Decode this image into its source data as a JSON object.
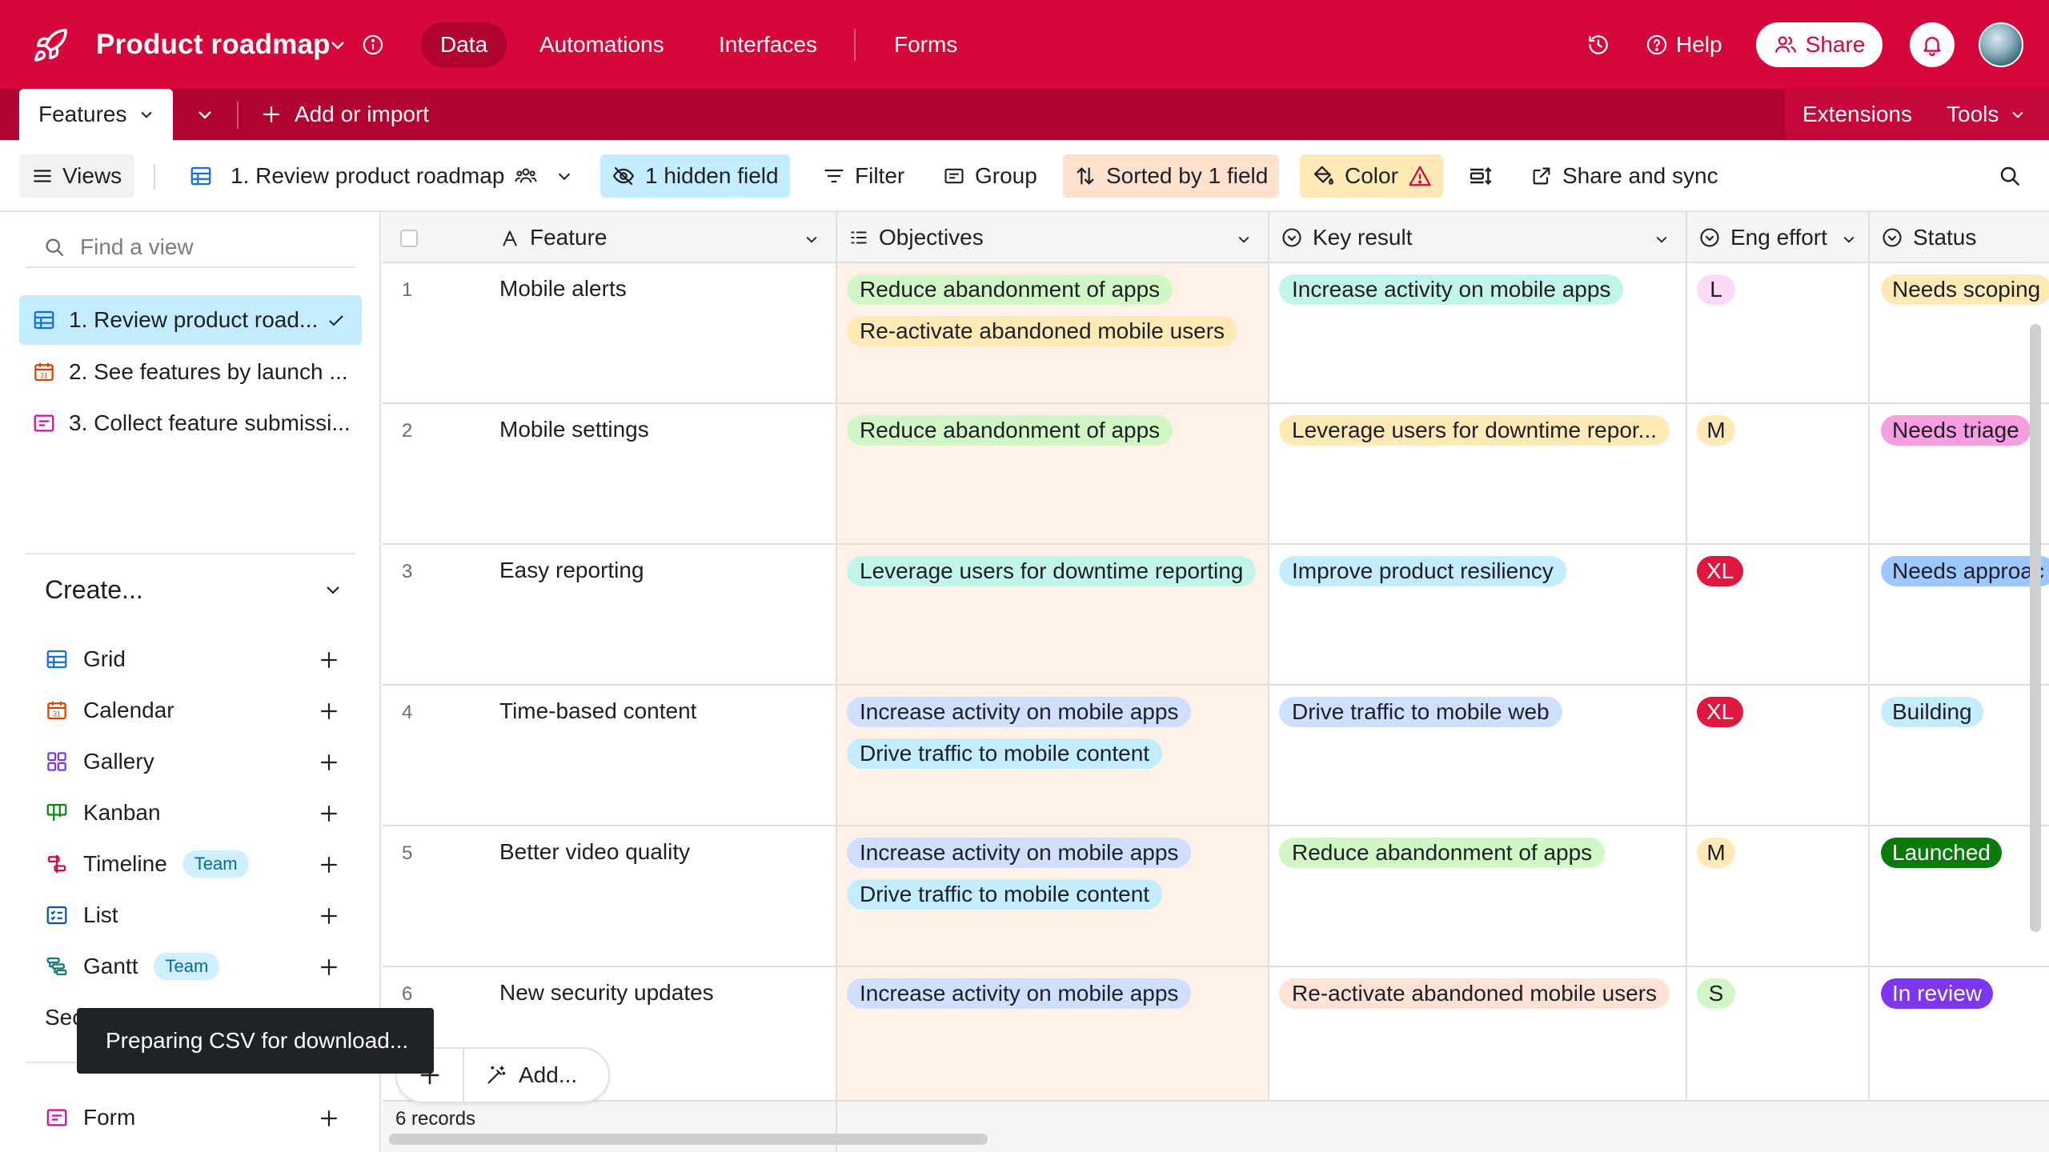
{
  "topbar": {
    "base_title": "Product roadmap",
    "nav": [
      "Data",
      "Automations",
      "Interfaces",
      "Forms"
    ],
    "help_label": "Help",
    "share_label": "Share"
  },
  "tabsbar": {
    "table_name": "Features",
    "add_import_label": "Add or import",
    "extensions_label": "Extensions",
    "tools_label": "Tools"
  },
  "viewbar": {
    "views_label": "Views",
    "current_view": "1. Review product roadmap",
    "hidden_fields": "1 hidden field",
    "filter": "Filter",
    "group": "Group",
    "sorted": "Sorted by 1 field",
    "color": "Color",
    "share_sync": "Share and sync"
  },
  "sidebar": {
    "find_placeholder": "Find a view",
    "views": [
      "1. Review product road...",
      "2. See features by launch ...",
      "3. Collect feature submissi..."
    ],
    "create_label": "Create...",
    "create_items": [
      "Grid",
      "Calendar",
      "Gallery",
      "Kanban",
      "Timeline",
      "List",
      "Gantt",
      "Sec",
      "Form"
    ],
    "team_badge": "Team"
  },
  "toast": {
    "message": "Preparing CSV for download..."
  },
  "grid": {
    "columns": [
      "Feature",
      "Objectives",
      "Key result",
      "Eng effort",
      "Status"
    ],
    "rows": [
      {
        "num": "1",
        "feature": "Mobile alerts",
        "objectives": [
          "Reduce abandonment of apps",
          "Re-activate abandoned mobile users"
        ],
        "key_result": "Increase activity on mobile apps",
        "effort": "L",
        "status": "Needs scoping"
      },
      {
        "num": "2",
        "feature": "Mobile settings",
        "objectives": [
          "Reduce abandonment of apps"
        ],
        "key_result": "Leverage users for downtime repor...",
        "effort": "M",
        "status": "Needs triage"
      },
      {
        "num": "3",
        "feature": "Easy reporting",
        "objectives": [
          "Leverage users for downtime reporting"
        ],
        "key_result": "Improve product resiliency",
        "effort": "XL",
        "status": "Needs approac"
      },
      {
        "num": "4",
        "feature": "Time-based content",
        "objectives": [
          "Increase activity on mobile apps",
          "Drive traffic to mobile content"
        ],
        "key_result": "Drive traffic to mobile web",
        "effort": "XL",
        "status": "Building"
      },
      {
        "num": "5",
        "feature": "Better video quality",
        "objectives": [
          "Increase activity on mobile apps",
          "Drive traffic to mobile content"
        ],
        "key_result": "Reduce abandonment of apps",
        "effort": "M",
        "status": "Launched"
      },
      {
        "num": "6",
        "feature": "New security updates",
        "objectives": [
          "Increase activity on mobile apps"
        ],
        "key_result": "Re-activate abandoned mobile users",
        "effort": "S",
        "status": "In review"
      }
    ],
    "add_label": "Add...",
    "records_label": "6 records"
  },
  "colors": {
    "brand": "#d6073a",
    "brand_dark": "#b0032f",
    "effort_L": "#ffdaf6",
    "effort_M": "#ffeab6",
    "effort_XL": "#e0173e",
    "effort_S": "#d1f7c4",
    "status_needs_scoping": "#ffeab6",
    "status_needs_triage": "#f99de2",
    "status_needs_approach": "#9cc7ff",
    "status_building": "#c4ecff",
    "status_launched": "#0a7a0a",
    "status_in_review": "#7c37ef"
  }
}
